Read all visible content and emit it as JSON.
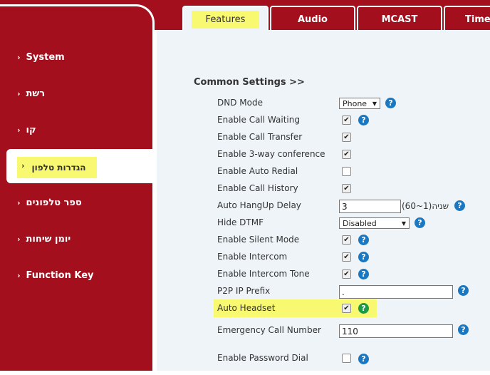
{
  "tabs": [
    {
      "label": "Features"
    },
    {
      "label": "Audio"
    },
    {
      "label": "MCAST"
    },
    {
      "label": "Time/I"
    }
  ],
  "sidebar": {
    "items": [
      {
        "label": "System"
      },
      {
        "label": "רשת"
      },
      {
        "label": "קו"
      },
      {
        "label": "הגדרות טלפון"
      },
      {
        "label": "ספר טלפונים"
      },
      {
        "label": "יומן שיחות"
      },
      {
        "label": "Function Key"
      }
    ]
  },
  "section": {
    "title": "Common Settings >>"
  },
  "rows": {
    "dnd": {
      "label": "DND Mode",
      "value": "Phone"
    },
    "call_waiting": {
      "label": "Enable Call Waiting",
      "checked": true
    },
    "call_transfer": {
      "label": "Enable Call Transfer",
      "checked": true
    },
    "three_way": {
      "label": "Enable 3-way conference",
      "checked": true
    },
    "auto_redial": {
      "label": "Enable Auto Redial",
      "checked": false
    },
    "call_history": {
      "label": "Enable Call History",
      "checked": true
    },
    "auto_hangup": {
      "label": "Auto HangUp Delay",
      "value": "3",
      "range": "(60~1)שניה"
    },
    "hide_dtmf": {
      "label": "Hide DTMF",
      "value": "Disabled"
    },
    "silent_mode": {
      "label": "Enable Silent Mode",
      "checked": true
    },
    "intercom": {
      "label": "Enable Intercom",
      "checked": true
    },
    "intercom_tone": {
      "label": "Enable Intercom Tone",
      "checked": true
    },
    "p2p_prefix": {
      "label": "P2P IP Prefix",
      "value": "."
    },
    "auto_headset": {
      "label": "Auto Headset",
      "checked": true
    },
    "emergency": {
      "label": "Emergency Call Number",
      "value": "110"
    },
    "password_dial": {
      "label": "Enable Password Dial",
      "checked": false
    }
  },
  "icons": {
    "check": "✔",
    "help": "?",
    "chevron": "›",
    "dropdown": "▼"
  },
  "colors": {
    "brand_red": "#a30f1c",
    "highlight": "#f8f871",
    "help_blue": "#1a78c2",
    "help_green": "#1c9a47",
    "panel_bg": "#eef4f8"
  }
}
